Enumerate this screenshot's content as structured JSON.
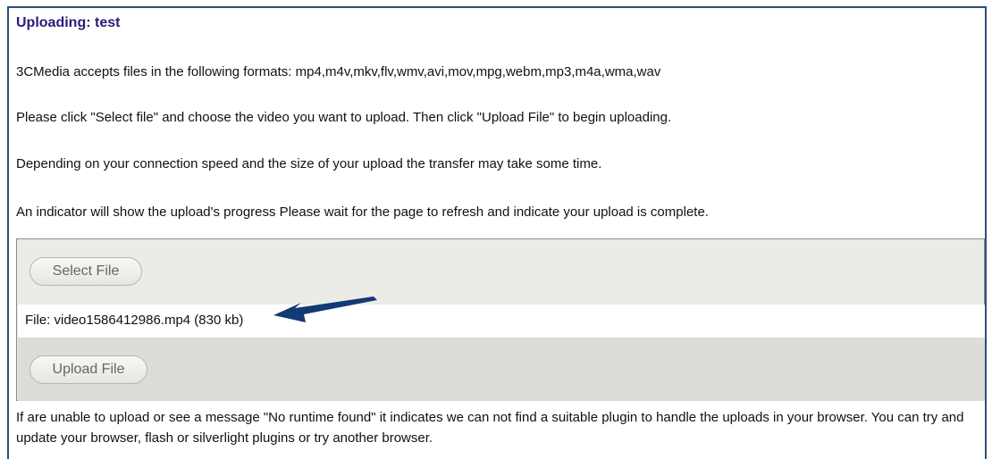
{
  "header": {
    "title": "Uploading: test"
  },
  "instructions": {
    "formats": "3CMedia accepts files in the following formats: mp4,m4v,mkv,flv,wmv,avi,mov,mpg,webm,mp3,m4a,wma,wav",
    "select_and_upload": "Please click \"Select file\" and choose the video you want to upload. Then click \"Upload File\" to begin uploading.",
    "speed_note": "Depending on your connection speed and the size of your upload the transfer may take some time.",
    "progress_note": "An indicator will show the upload's progress Please wait for the page to refresh and indicate your upload is complete."
  },
  "uploader": {
    "select_button_label": "Select File",
    "file_info": "File: video1586412986.mp4 (830 kb)",
    "upload_button_label": "Upload File"
  },
  "footer": {
    "runtime_note": "If are unable to upload or see a message \"No runtime found\" it indicates we can not find a suitable plugin to handle the uploads in your browser. You can try and update your browser, flash or silverlight plugins or try another browser."
  },
  "annotation": {
    "arrow_icon": "left-arrow-icon",
    "arrow_color": "#123a75"
  },
  "colors": {
    "title": "#2b1a78",
    "frame_border": "#2f4e7a",
    "upload_panel_top": "#ecece6",
    "upload_panel_bottom": "#dddcd6"
  }
}
